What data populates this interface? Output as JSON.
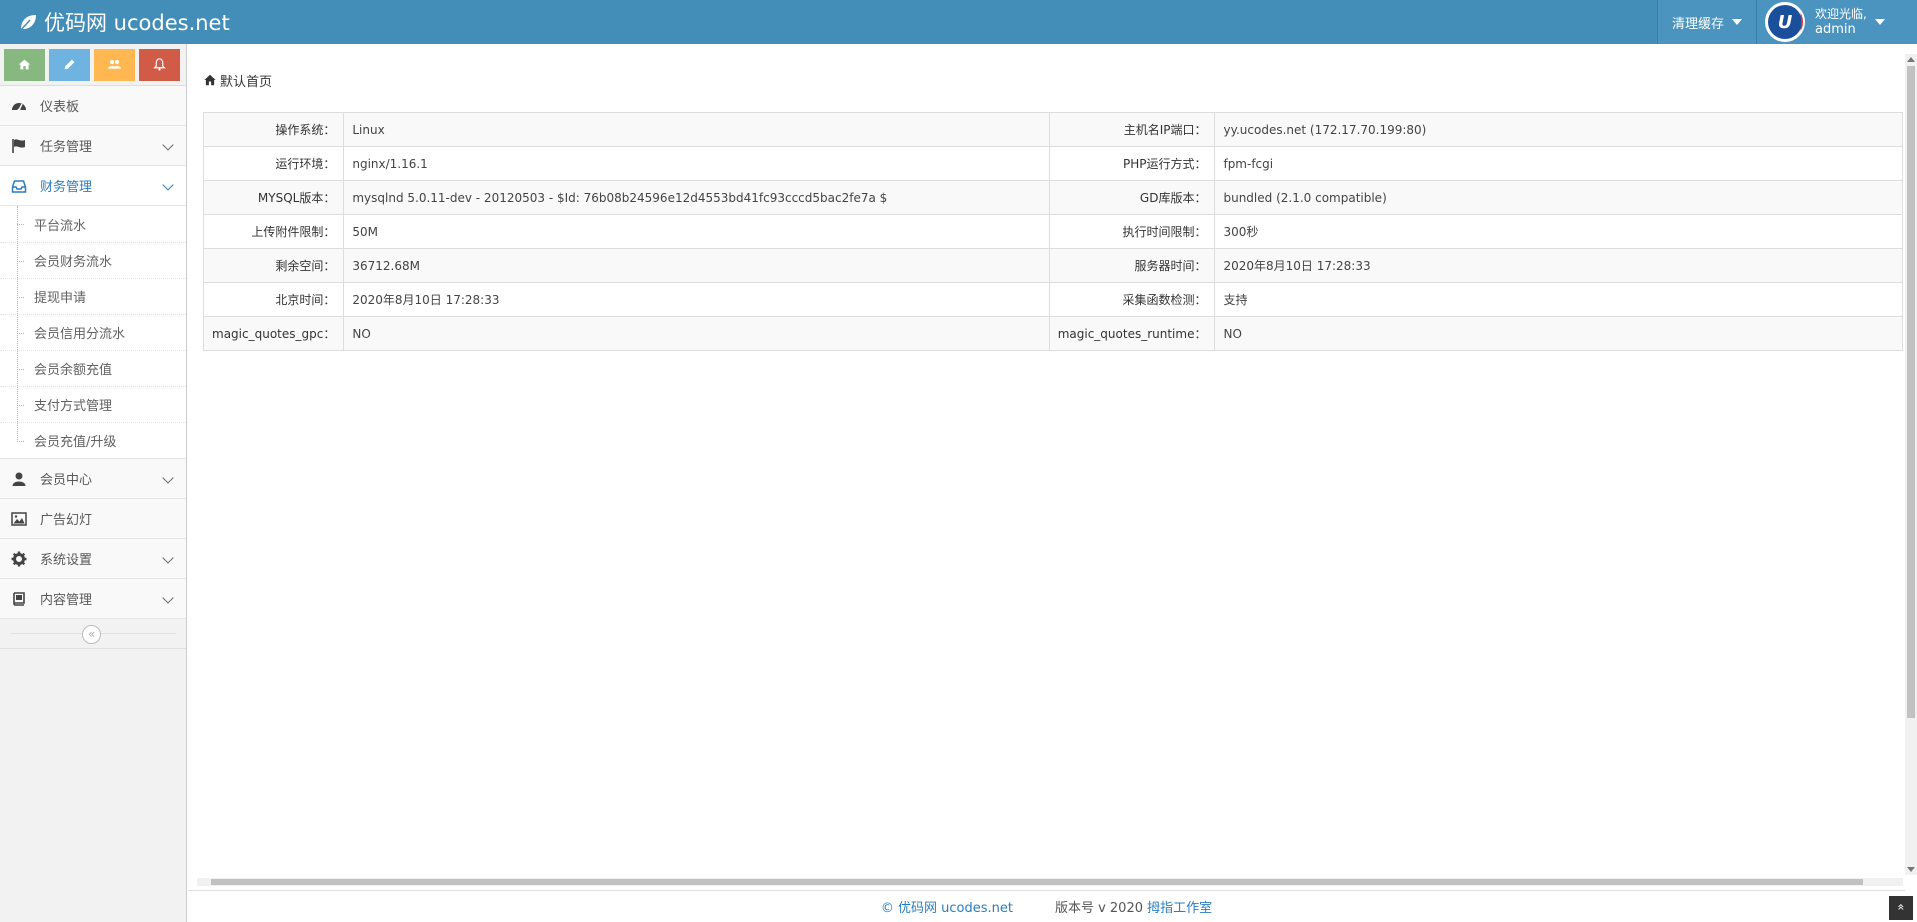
{
  "app": {
    "brand_title": "优码网 ucodes.net"
  },
  "navbar": {
    "clear_cache_label": "清理缓存",
    "welcome_text": "欢迎光临,",
    "username": "admin"
  },
  "shortcuts": [
    {
      "icon": "home-icon",
      "color": "#87b87f"
    },
    {
      "icon": "pencil-icon",
      "color": "#6fb3e0"
    },
    {
      "icon": "users-icon",
      "color": "#ffb752"
    },
    {
      "icon": "bell-icon",
      "color": "#d15b47"
    }
  ],
  "sidebar": {
    "dashboard": "仪表板",
    "tasks": "任务管理",
    "finance": "财务管理",
    "finance_sub": [
      "平台流水",
      "会员财务流水",
      "提现申请",
      "会员信用分流水",
      "会员余额充值",
      "支付方式管理",
      "会员充值/升级"
    ],
    "members": "会员中心",
    "ads": "广告幻灯",
    "settings": "系统设置",
    "content": "内容管理",
    "collapse_glyph": "«"
  },
  "breadcrumb": {
    "home": "默认首页"
  },
  "system_info": [
    {
      "l1": "操作系统：",
      "v1": "Linux",
      "l2": "主机名IP端口：",
      "v2": "yy.ucodes.net (172.17.70.199:80)"
    },
    {
      "l1": "运行环境：",
      "v1": "nginx/1.16.1",
      "l2": "PHP运行方式：",
      "v2": "fpm-fcgi"
    },
    {
      "l1": "MYSQL版本：",
      "v1": "mysqlnd 5.0.11-dev - 20120503 - $Id: 76b08b24596e12d4553bd41fc93cccd5bac2fe7a $",
      "l2": "GD库版本：",
      "v2": "bundled (2.1.0 compatible)"
    },
    {
      "l1": "上传附件限制：",
      "v1": "50M",
      "l2": "执行时间限制：",
      "v2": "300秒"
    },
    {
      "l1": "剩余空间：",
      "v1": "36712.68M",
      "l2": "服务器时间：",
      "v2": "2020年8月10日 17:28:33"
    },
    {
      "l1": "北京时间：",
      "v1": "2020年8月10日 17:28:33",
      "l2": "采集函数检测：",
      "v2": "支持"
    },
    {
      "l1": "magic_quotes_gpc：",
      "v1": "NO",
      "l2": "magic_quotes_runtime：",
      "v2": "NO"
    }
  ],
  "footer": {
    "copyright": "© 优码网 ucodes.net",
    "version_text": "版本号 v 2020",
    "studio": "拇指工作室",
    "back_to_top": "»"
  },
  "colors": {
    "navbar": "#438eb9",
    "sidebar_bg": "#f2f2f2",
    "link": "#2b7dbc"
  }
}
